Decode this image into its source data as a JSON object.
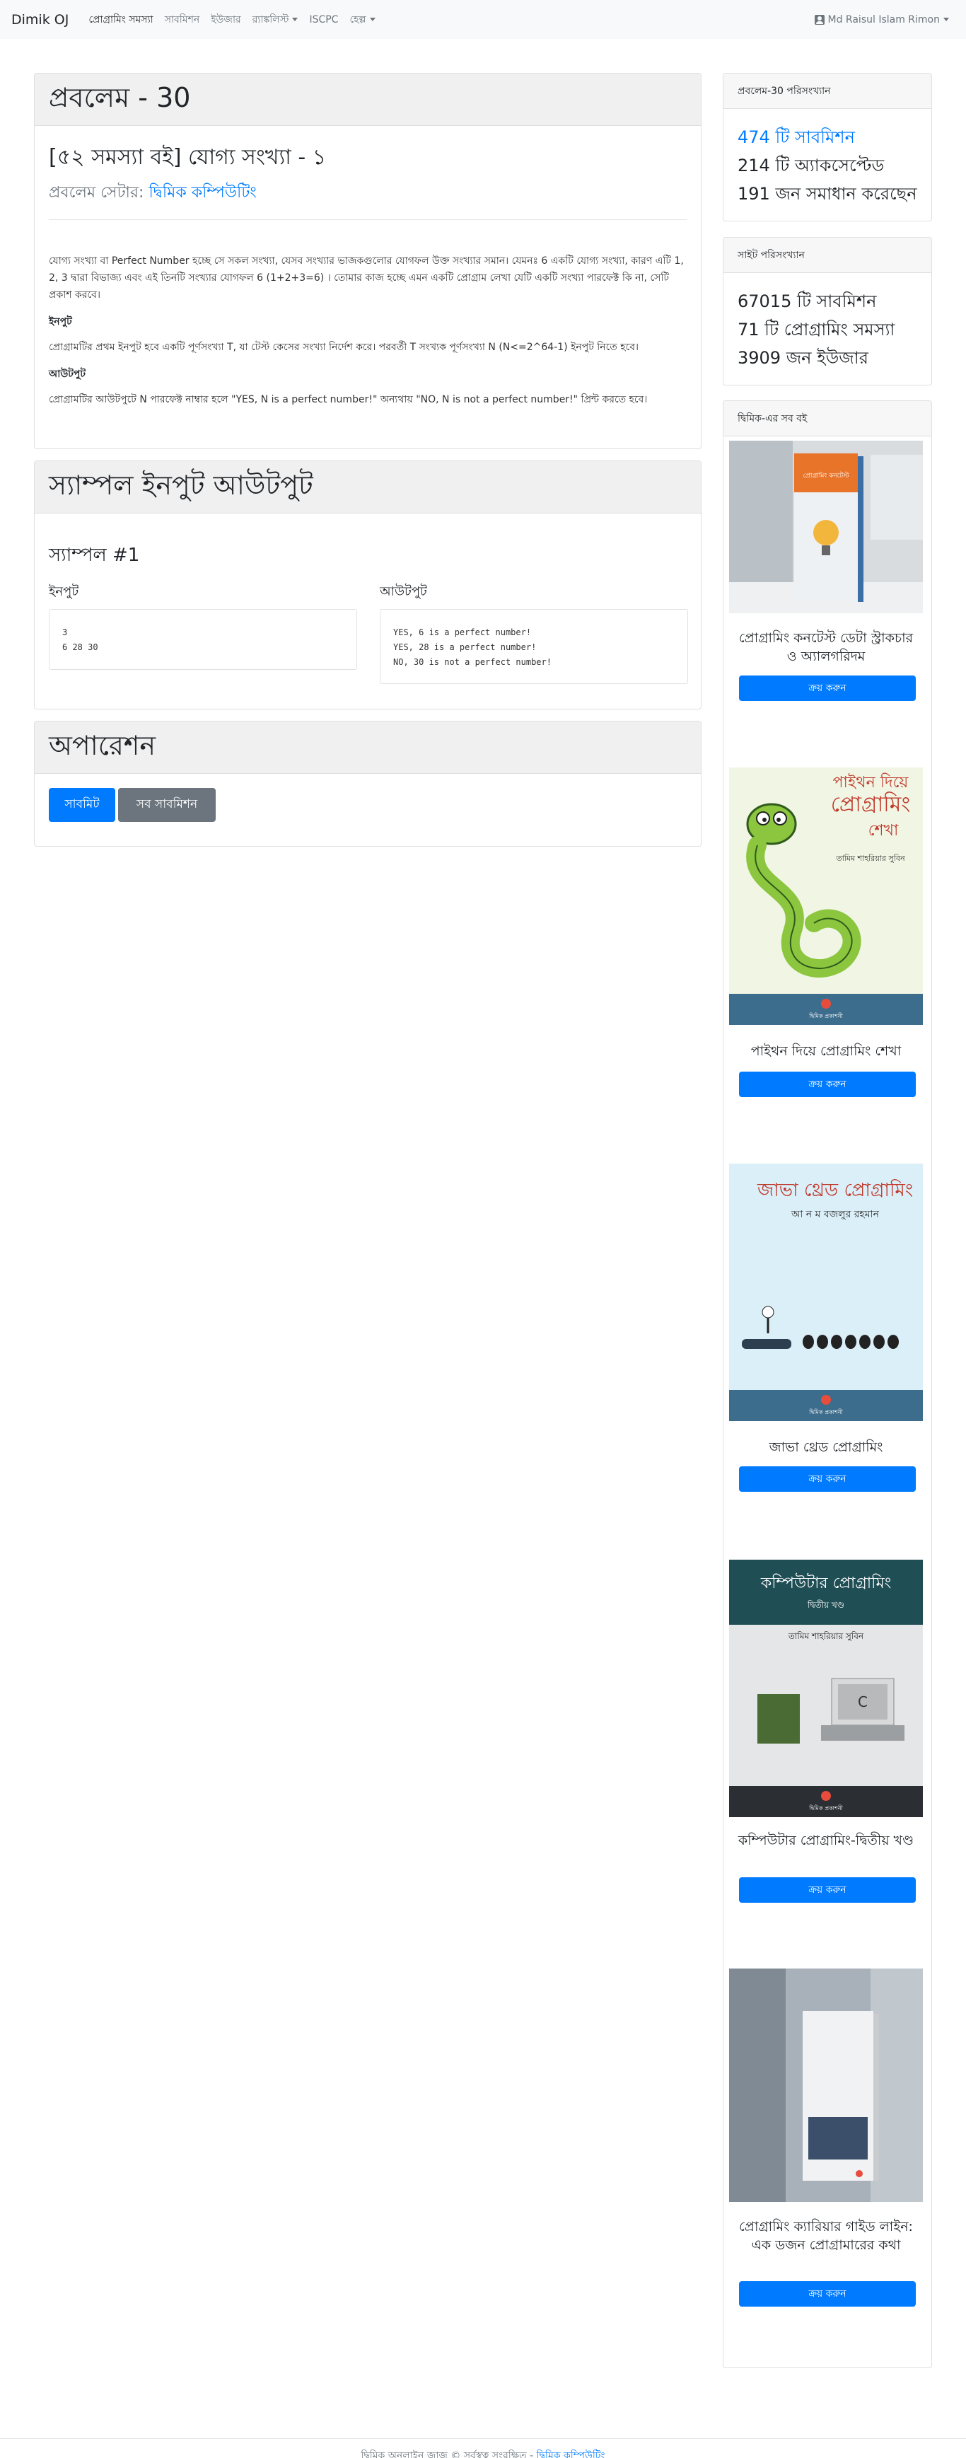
{
  "navbar": {
    "brand": "Dimik OJ",
    "items": [
      {
        "label": "প্রোগ্রামিং সমস্যা",
        "active": true
      },
      {
        "label": "সাবমিশন"
      },
      {
        "label": "ইউজার"
      },
      {
        "label": "র‍্যাঙ্কলিস্ট"
      },
      {
        "label": "ISCPC"
      },
      {
        "label": "হেল্প"
      }
    ],
    "user": "Md Raisul Islam Rimon"
  },
  "problem": {
    "header": "প্রবলেম - 30",
    "title": "[৫২ সমস্যা বই] যোগ্য সংখ্যা - ১",
    "setter_prefix": "প্রবলেম সেটার:",
    "setter_name": "দ্বিমিক কম্পিউটিং",
    "description": "যোগ্য সংখ্যা বা Perfect Number হচ্ছে সে সকল সংখ্যা, যেসব সংখ্যার ভাজকগুলোর যোগফল উক্ত সংখ্যার সমান। যেমনঃ 6 একটি যোগ্য সংখ্যা, কারণ এটি 1, 2, 3 দ্বারা বিভাজ্য এবং এই তিনটি সংখ্যার যোগফল 6 (1+2+3=6) । তোমার কাজ হচ্ছে এমন একটি প্রোগ্রাম লেখা যেটি একটি সংখ্যা পারফেক্ট কি না, সেটি প্রকাশ করবে।",
    "input_heading": "ইনপুট",
    "input_text": "প্রোগ্রামটির প্রথম ইনপুট হবে একটি পূর্ণসংখ্যা T, যা টেস্ট কেসের সংখ্যা নির্দেশ করে। পরবর্তী T সংখ্যক পূর্ণসংখ্যা N (N<=2^64-1) ইনপুট নিতে হবে।",
    "output_heading": "আউটপুট",
    "output_text": "প্রোগ্রামটির আউটপুটে N পারফেক্ট নাম্বার হলে \"YES, N is a perfect number!\" অন্যথায় \"NO, N is not a perfect number!\" প্রিন্ট করতে হবে।"
  },
  "samples": {
    "header": "স্যাম্পল ইনপুট আউটপুট",
    "sample_title": "স্যাম্পল #1",
    "input_label": "ইনপুট",
    "output_label": "আউটপুট",
    "input": "3\n6 28 30",
    "output": "YES, 6 is a perfect number!\nYES, 28 is a perfect number!\nNO, 30 is not a perfect number!"
  },
  "operations": {
    "header": "অপারেশন",
    "submit": "সাবমিট",
    "all_submissions": "সব সাবমিশন"
  },
  "problem_stats": {
    "header": "প্রবলেম-30 পরিসংখ্যান",
    "submissions": "474 টি সাবমিশন",
    "accepted": "214 টি অ্যাকসেপ্টেড",
    "solvers": "191 জন সমাধান করেছেন"
  },
  "site_stats": {
    "header": "সাইট পরিসংখ্যান",
    "submissions": "67015 টি সাবমিশন",
    "problems": "71 টি প্রোগ্রামিং সমস্যা",
    "users": "3909 জন ইউজার"
  },
  "books": {
    "header": "দ্বিমিক-এর সব বই",
    "buy_label": "ক্রয় করুন",
    "items": [
      {
        "title": "প্রোগ্রামিং কনটেস্ট ডেটা স্ট্রাকচার ও অ্যালগরিদম",
        "cover_text": "প্রোগ্রামিং কনটেস্ট"
      },
      {
        "title": "পাইথন দিয়ে প্রোগ্রামিং শেখা",
        "cover_line1": "পাইথন দিয়ে",
        "cover_line2": "প্রোগ্রামিং",
        "cover_line3": "শেখা",
        "cover_author": "তামিম শাহরিয়ার সুবিন"
      },
      {
        "title": "জাভা থ্রেড প্রোগ্রামিং",
        "cover_line1": "জাভা থ্রেড প্রোগ্রামিং",
        "cover_author": "আ ন ম বজলুর রহমান"
      },
      {
        "title": "কম্পিউটার প্রোগ্রামিং-দ্বিতীয় খণ্ড",
        "cover_line1": "কম্পিউটার প্রোগ্রামিং",
        "cover_line2": "দ্বিতীয় খণ্ড",
        "cover_author": "তামিম শাহরিয়ার সুবিন"
      },
      {
        "title": "প্রোগ্রামিং ক্যারিয়ার গাইড লাইন: এক ডজন প্রোগ্রামারের কথা"
      }
    ],
    "publisher": "দ্বিমিক প্রকাশনী"
  },
  "footer": {
    "text": "দ্বিমিক অনলাইন জাজ © সর্বস্বত্ব সংরক্ষিত -",
    "link": "দ্বিমিক কম্পিউটিং"
  },
  "colors": {
    "primary": "#007bff",
    "secondary": "#6c757d",
    "navbar_bg": "#f8f9fa"
  }
}
